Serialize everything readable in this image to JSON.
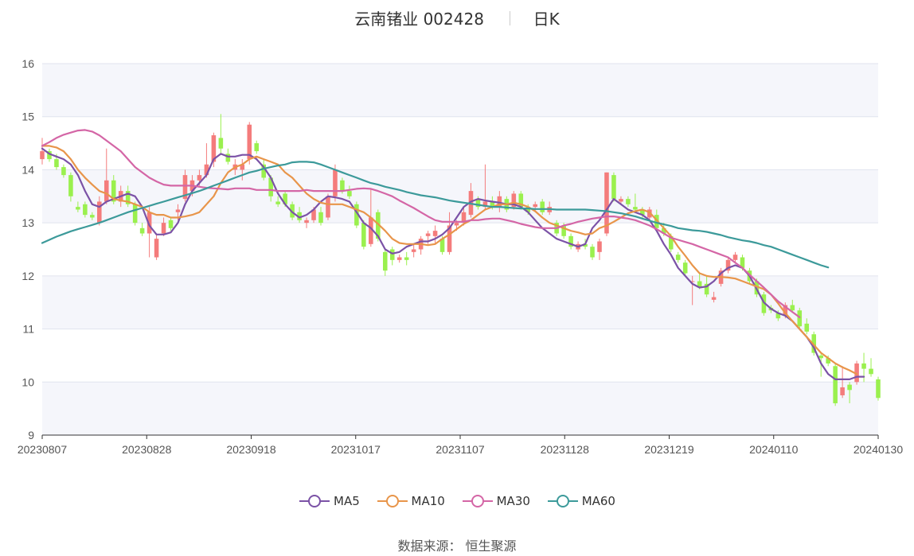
{
  "header": {
    "title": "云南锗业 002428",
    "period": "日K"
  },
  "source_label": "数据来源：  恒生聚源",
  "colors": {
    "up": "#f47c7c",
    "down": "#9af04e",
    "MA5": "#7b52a6",
    "MA10": "#e8954a",
    "MA30": "#d466a6",
    "MA60": "#3c9a9a"
  },
  "chart_data": {
    "type": "candlestick",
    "ylim": [
      9,
      16
    ],
    "yticks": [
      "9",
      "10",
      "11",
      "12",
      "13",
      "14",
      "15",
      "16"
    ],
    "x_tick_labels": [
      "20230807",
      "20230828",
      "20230918",
      "20231017",
      "20231107",
      "20231128",
      "20231219",
      "20240110",
      "20240130"
    ],
    "legend": [
      "MA5",
      "MA10",
      "MA30",
      "MA60"
    ],
    "ohlc": [
      [
        14.2,
        14.6,
        14.1,
        14.35
      ],
      [
        14.35,
        14.4,
        14.15,
        14.2
      ],
      [
        14.2,
        14.3,
        14.0,
        14.05
      ],
      [
        14.05,
        14.1,
        13.85,
        13.9
      ],
      [
        13.9,
        13.95,
        13.4,
        13.5
      ],
      [
        13.3,
        13.4,
        13.2,
        13.25
      ],
      [
        13.35,
        13.4,
        13.1,
        13.15
      ],
      [
        13.15,
        13.2,
        13.05,
        13.1
      ],
      [
        13.0,
        13.5,
        12.95,
        13.4
      ],
      [
        13.4,
        14.4,
        13.35,
        13.8
      ],
      [
        13.8,
        13.9,
        13.35,
        13.4
      ],
      [
        13.4,
        13.7,
        13.3,
        13.6
      ],
      [
        13.6,
        13.7,
        13.3,
        13.35
      ],
      [
        13.35,
        13.4,
        12.95,
        13.0
      ],
      [
        12.9,
        13.0,
        12.75,
        12.8
      ],
      [
        12.8,
        13.3,
        12.35,
        13.2
      ],
      [
        12.35,
        12.8,
        12.3,
        12.7
      ],
      [
        12.8,
        13.1,
        12.75,
        13.0
      ],
      [
        13.05,
        13.1,
        12.85,
        12.9
      ],
      [
        13.2,
        13.35,
        13.05,
        13.25
      ],
      [
        13.45,
        14.0,
        13.4,
        13.9
      ],
      [
        13.6,
        13.9,
        13.5,
        13.8
      ],
      [
        13.8,
        14.0,
        13.7,
        13.9
      ],
      [
        13.9,
        14.5,
        13.85,
        14.1
      ],
      [
        14.15,
        14.7,
        14.05,
        14.65
      ],
      [
        14.6,
        15.05,
        14.3,
        14.4
      ],
      [
        14.3,
        14.4,
        14.1,
        14.15
      ],
      [
        14.0,
        14.2,
        13.9,
        14.1
      ],
      [
        14.0,
        14.2,
        13.8,
        14.1
      ],
      [
        14.2,
        14.9,
        14.1,
        14.85
      ],
      [
        14.5,
        14.55,
        14.3,
        14.35
      ],
      [
        14.1,
        14.2,
        13.8,
        13.85
      ],
      [
        13.85,
        13.9,
        13.4,
        13.5
      ],
      [
        13.4,
        13.5,
        13.3,
        13.35
      ],
      [
        13.55,
        13.6,
        13.3,
        13.35
      ],
      [
        13.35,
        13.4,
        13.05,
        13.1
      ],
      [
        13.2,
        13.3,
        13.0,
        13.05
      ],
      [
        13.0,
        13.1,
        12.9,
        13.05
      ],
      [
        13.05,
        13.3,
        13.0,
        13.25
      ],
      [
        13.2,
        13.3,
        12.95,
        13.0
      ],
      [
        13.1,
        13.55,
        13.05,
        13.5
      ],
      [
        13.5,
        14.1,
        13.4,
        14.0
      ],
      [
        13.8,
        13.85,
        13.55,
        13.6
      ],
      [
        13.6,
        13.7,
        13.45,
        13.5
      ],
      [
        13.35,
        13.4,
        12.9,
        12.95
      ],
      [
        13.0,
        13.05,
        12.5,
        12.55
      ],
      [
        12.6,
        13.65,
        12.55,
        13.1
      ],
      [
        13.2,
        13.25,
        12.65,
        12.7
      ],
      [
        12.45,
        12.5,
        12.0,
        12.1
      ],
      [
        12.5,
        12.55,
        12.2,
        12.3
      ],
      [
        12.3,
        12.4,
        12.25,
        12.35
      ],
      [
        12.35,
        12.45,
        12.2,
        12.3
      ],
      [
        12.45,
        12.6,
        12.35,
        12.5
      ],
      [
        12.5,
        12.75,
        12.4,
        12.7
      ],
      [
        12.75,
        12.85,
        12.6,
        12.8
      ],
      [
        12.75,
        12.95,
        12.6,
        12.85
      ],
      [
        12.7,
        12.75,
        12.4,
        12.45
      ],
      [
        12.45,
        13.2,
        12.4,
        12.95
      ],
      [
        12.95,
        13.05,
        12.85,
        13.0
      ],
      [
        13.0,
        13.3,
        12.95,
        13.2
      ],
      [
        13.15,
        13.75,
        13.1,
        13.6
      ],
      [
        13.45,
        13.5,
        13.25,
        13.3
      ],
      [
        13.3,
        14.1,
        13.25,
        13.4
      ],
      [
        13.4,
        13.5,
        13.25,
        13.3
      ],
      [
        13.3,
        13.6,
        13.2,
        13.5
      ],
      [
        13.45,
        13.5,
        13.2,
        13.25
      ],
      [
        13.3,
        13.6,
        13.25,
        13.55
      ],
      [
        13.55,
        13.6,
        13.25,
        13.3
      ],
      [
        13.3,
        13.35,
        13.15,
        13.2
      ],
      [
        13.3,
        13.4,
        13.2,
        13.35
      ],
      [
        13.4,
        13.45,
        13.15,
        13.2
      ],
      [
        13.2,
        13.4,
        13.15,
        13.3
      ],
      [
        13.0,
        13.05,
        12.75,
        12.8
      ],
      [
        12.95,
        13.0,
        12.7,
        12.75
      ],
      [
        12.75,
        12.8,
        12.5,
        12.55
      ],
      [
        12.5,
        12.65,
        12.45,
        12.6
      ],
      [
        12.6,
        12.7,
        12.5,
        12.55
      ],
      [
        12.55,
        12.6,
        12.3,
        12.35
      ],
      [
        12.45,
        12.7,
        12.3,
        12.65
      ],
      [
        12.8,
        13.95,
        12.75,
        13.95
      ],
      [
        13.9,
        13.95,
        13.4,
        13.45
      ],
      [
        13.4,
        13.5,
        13.35,
        13.45
      ],
      [
        13.45,
        13.5,
        13.3,
        13.35
      ],
      [
        13.3,
        13.55,
        13.2,
        13.25
      ],
      [
        13.25,
        13.3,
        13.1,
        13.15
      ],
      [
        13.1,
        13.3,
        13.05,
        13.25
      ],
      [
        13.15,
        13.25,
        12.85,
        12.9
      ],
      [
        12.9,
        13.0,
        12.75,
        12.8
      ],
      [
        12.75,
        12.8,
        12.45,
        12.5
      ],
      [
        12.4,
        12.45,
        12.25,
        12.3
      ],
      [
        12.25,
        12.3,
        12.0,
        12.05
      ],
      [
        11.9,
        12.0,
        11.45,
        11.9
      ],
      [
        11.9,
        12.05,
        11.75,
        11.8
      ],
      [
        11.85,
        12.0,
        11.6,
        11.65
      ],
      [
        11.55,
        11.7,
        11.5,
        11.6
      ],
      [
        11.85,
        12.15,
        11.8,
        12.1
      ],
      [
        12.1,
        12.35,
        12.05,
        12.3
      ],
      [
        12.3,
        12.45,
        12.25,
        12.4
      ],
      [
        12.35,
        12.4,
        12.1,
        12.15
      ],
      [
        12.1,
        12.15,
        11.85,
        11.9
      ],
      [
        11.9,
        11.95,
        11.6,
        11.65
      ],
      [
        11.65,
        11.7,
        11.25,
        11.3
      ],
      [
        11.4,
        11.45,
        11.3,
        11.35
      ],
      [
        11.3,
        11.35,
        11.15,
        11.2
      ],
      [
        11.25,
        11.5,
        11.2,
        11.45
      ],
      [
        11.45,
        11.55,
        11.3,
        11.35
      ],
      [
        11.35,
        11.4,
        11.0,
        11.05
      ],
      [
        11.1,
        11.2,
        10.9,
        10.95
      ],
      [
        10.9,
        10.95,
        10.5,
        10.55
      ],
      [
        10.5,
        10.55,
        10.1,
        10.45
      ],
      [
        10.45,
        10.5,
        10.3,
        10.35
      ],
      [
        10.3,
        10.35,
        9.55,
        9.6
      ],
      [
        9.75,
        10.3,
        9.7,
        9.9
      ],
      [
        9.95,
        10.0,
        9.6,
        9.85
      ],
      [
        10.0,
        10.4,
        9.95,
        10.35
      ],
      [
        10.35,
        10.55,
        10.0,
        10.25
      ],
      [
        10.25,
        10.45,
        10.1,
        10.15
      ],
      [
        10.05,
        10.1,
        9.65,
        9.7
      ]
    ],
    "series": [
      {
        "name": "MA5",
        "values": [
          14.4,
          14.3,
          14.25,
          14.2,
          14.1,
          13.9,
          13.6,
          13.35,
          13.3,
          13.4,
          13.45,
          13.5,
          13.55,
          13.5,
          13.3,
          12.95,
          12.78,
          12.78,
          12.82,
          13.0,
          13.35,
          13.6,
          13.75,
          13.9,
          14.2,
          14.3,
          14.25,
          14.25,
          14.28,
          14.28,
          14.2,
          14.05,
          13.85,
          13.55,
          13.35,
          13.2,
          13.1,
          13.15,
          13.25,
          13.4,
          13.5,
          13.48,
          13.45,
          13.4,
          13.2,
          13.0,
          12.9,
          12.75,
          12.5,
          12.42,
          12.45,
          12.55,
          12.6,
          12.65,
          12.65,
          12.7,
          12.78,
          12.9,
          13.1,
          13.3,
          13.4,
          13.45,
          13.42,
          13.4,
          13.38,
          13.35,
          13.35,
          13.3,
          13.2,
          13.05,
          12.9,
          12.8,
          12.7,
          12.65,
          12.6,
          12.55,
          12.6,
          12.9,
          13.05,
          13.25,
          13.45,
          13.35,
          13.25,
          13.2,
          13.15,
          13.05,
          12.85,
          12.6,
          12.4,
          12.15,
          12.0,
          11.85,
          11.78,
          11.8,
          11.9,
          12.05,
          12.15,
          12.2,
          12.15,
          12.0,
          11.75,
          11.5,
          11.38,
          11.3,
          11.25,
          11.15,
          11.0,
          10.85,
          10.65,
          10.35,
          10.15,
          10.05,
          10.05,
          10.05,
          10.1,
          10.1
        ]
      },
      {
        "name": "MA10",
        "values": [
          14.45,
          14.45,
          14.42,
          14.35,
          14.2,
          14.0,
          13.85,
          13.72,
          13.6,
          13.55,
          13.45,
          13.42,
          13.4,
          13.35,
          13.3,
          13.2,
          13.15,
          13.15,
          13.1,
          13.1,
          13.12,
          13.15,
          13.2,
          13.35,
          13.5,
          13.75,
          13.95,
          14.05,
          14.1,
          14.2,
          14.25,
          14.2,
          14.15,
          14.1,
          13.95,
          13.85,
          13.7,
          13.55,
          13.45,
          13.38,
          13.35,
          13.35,
          13.35,
          13.3,
          13.25,
          13.2,
          13.1,
          12.98,
          12.85,
          12.7,
          12.62,
          12.6,
          12.6,
          12.6,
          12.58,
          12.6,
          12.7,
          12.78,
          12.88,
          12.98,
          13.05,
          13.15,
          13.25,
          13.3,
          13.35,
          13.35,
          13.38,
          13.35,
          13.3,
          13.22,
          13.1,
          13.0,
          12.95,
          12.9,
          12.85,
          12.82,
          12.78,
          12.8,
          12.9,
          12.95,
          13.02,
          13.1,
          13.18,
          13.22,
          13.25,
          13.2,
          13.05,
          12.9,
          12.75,
          12.55,
          12.38,
          12.2,
          12.05,
          12.0,
          11.98,
          11.98,
          11.97,
          11.95,
          11.9,
          11.85,
          11.8,
          11.75,
          11.65,
          11.48,
          11.3,
          11.15,
          11.0,
          10.85,
          10.7,
          10.55,
          10.45,
          10.35,
          10.28,
          10.22,
          10.15
        ]
      },
      {
        "name": "MA30",
        "values": [
          14.45,
          14.52,
          14.6,
          14.66,
          14.7,
          14.74,
          14.75,
          14.72,
          14.65,
          14.55,
          14.45,
          14.35,
          14.2,
          14.05,
          13.95,
          13.85,
          13.78,
          13.72,
          13.7,
          13.7,
          13.7,
          13.7,
          13.68,
          13.66,
          13.65,
          13.64,
          13.63,
          13.65,
          13.65,
          13.65,
          13.62,
          13.62,
          13.62,
          13.6,
          13.6,
          13.6,
          13.6,
          13.62,
          13.6,
          13.6,
          13.6,
          13.6,
          13.6,
          13.62,
          13.64,
          13.65,
          13.64,
          13.6,
          13.55,
          13.5,
          13.42,
          13.35,
          13.28,
          13.2,
          13.12,
          13.05,
          13.02,
          13.02,
          13.02,
          13.02,
          13.05,
          13.05,
          13.07,
          13.08,
          13.08,
          13.05,
          13.02,
          12.98,
          12.95,
          12.92,
          12.9,
          12.9,
          12.9,
          12.95,
          12.98,
          13.02,
          13.05,
          13.08,
          13.1,
          13.12,
          13.12,
          13.1,
          13.08,
          13.05,
          13.0,
          12.95,
          12.88,
          12.8,
          12.72,
          12.68,
          12.64,
          12.6,
          12.55,
          12.5,
          12.45,
          12.4,
          12.35,
          12.25,
          12.15,
          12.02,
          11.9,
          11.78,
          11.65,
          11.52,
          11.42,
          11.32,
          11.22
        ]
      },
      {
        "name": "MA60",
        "values": [
          12.62,
          12.68,
          12.74,
          12.79,
          12.84,
          12.88,
          12.92,
          12.96,
          13.0,
          13.05,
          13.1,
          13.15,
          13.2,
          13.24,
          13.28,
          13.32,
          13.36,
          13.4,
          13.44,
          13.48,
          13.52,
          13.56,
          13.6,
          13.65,
          13.7,
          13.75,
          13.8,
          13.85,
          13.9,
          13.95,
          13.98,
          14.02,
          14.05,
          14.08,
          14.1,
          14.14,
          14.15,
          14.15,
          14.14,
          14.1,
          14.05,
          14.0,
          13.95,
          13.9,
          13.85,
          13.8,
          13.75,
          13.72,
          13.68,
          13.65,
          13.62,
          13.58,
          13.55,
          13.52,
          13.5,
          13.48,
          13.45,
          13.42,
          13.4,
          13.38,
          13.36,
          13.34,
          13.32,
          13.3,
          13.3,
          13.29,
          13.28,
          13.27,
          13.27,
          13.26,
          13.26,
          13.26,
          13.25,
          13.25,
          13.25,
          13.25,
          13.25,
          13.24,
          13.23,
          13.22,
          13.2,
          13.18,
          13.15,
          13.12,
          13.08,
          13.04,
          13.0,
          12.97,
          12.94,
          12.9,
          12.88,
          12.86,
          12.85,
          12.83,
          12.8,
          12.77,
          12.73,
          12.7,
          12.67,
          12.65,
          12.62,
          12.58,
          12.55,
          12.5,
          12.45,
          12.4,
          12.35,
          12.3,
          12.25,
          12.2,
          12.16
        ]
      }
    ]
  }
}
